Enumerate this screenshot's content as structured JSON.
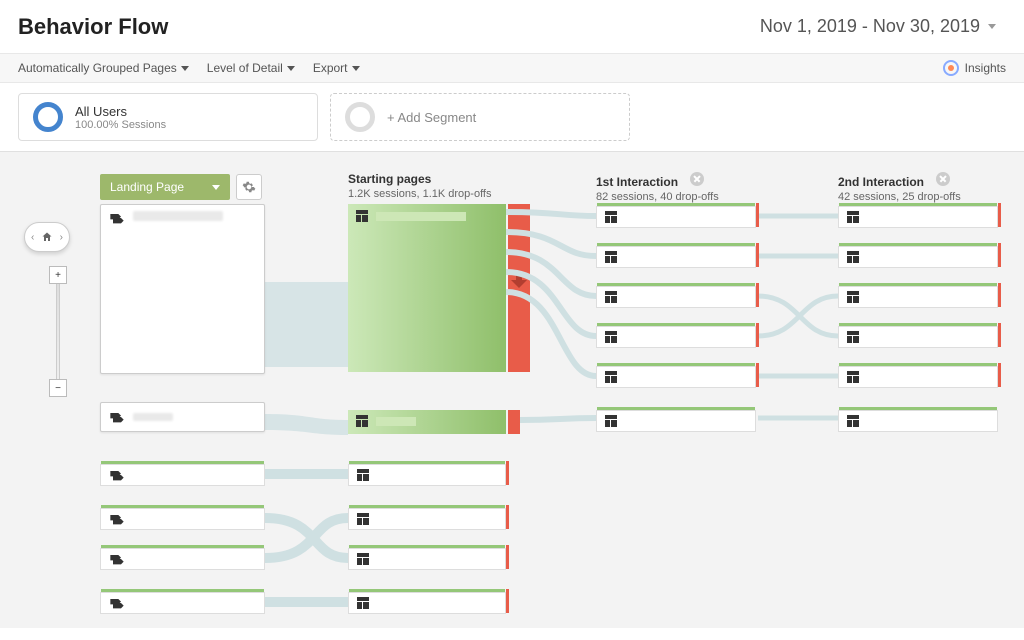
{
  "page": {
    "title": "Behavior Flow",
    "date_range": "Nov 1, 2019 - Nov 30, 2019"
  },
  "toolbar": {
    "grouping": "Automatically Grouped Pages",
    "detail": "Level of Detail",
    "export": "Export",
    "insights": "Insights"
  },
  "segments": {
    "all_users": {
      "title": "All Users",
      "sub": "100.00% Sessions"
    },
    "add": "+ Add Segment"
  },
  "dimension": {
    "label": "Landing Page"
  },
  "columns": {
    "start": {
      "title": "Starting pages",
      "sub": "1.2K sessions, 1.1K drop-offs"
    },
    "int1": {
      "title": "1st Interaction",
      "sub": "82 sessions, 40 drop-offs"
    },
    "int2": {
      "title": "2nd Interaction",
      "sub": "42 sessions, 25 drop-offs"
    }
  }
}
